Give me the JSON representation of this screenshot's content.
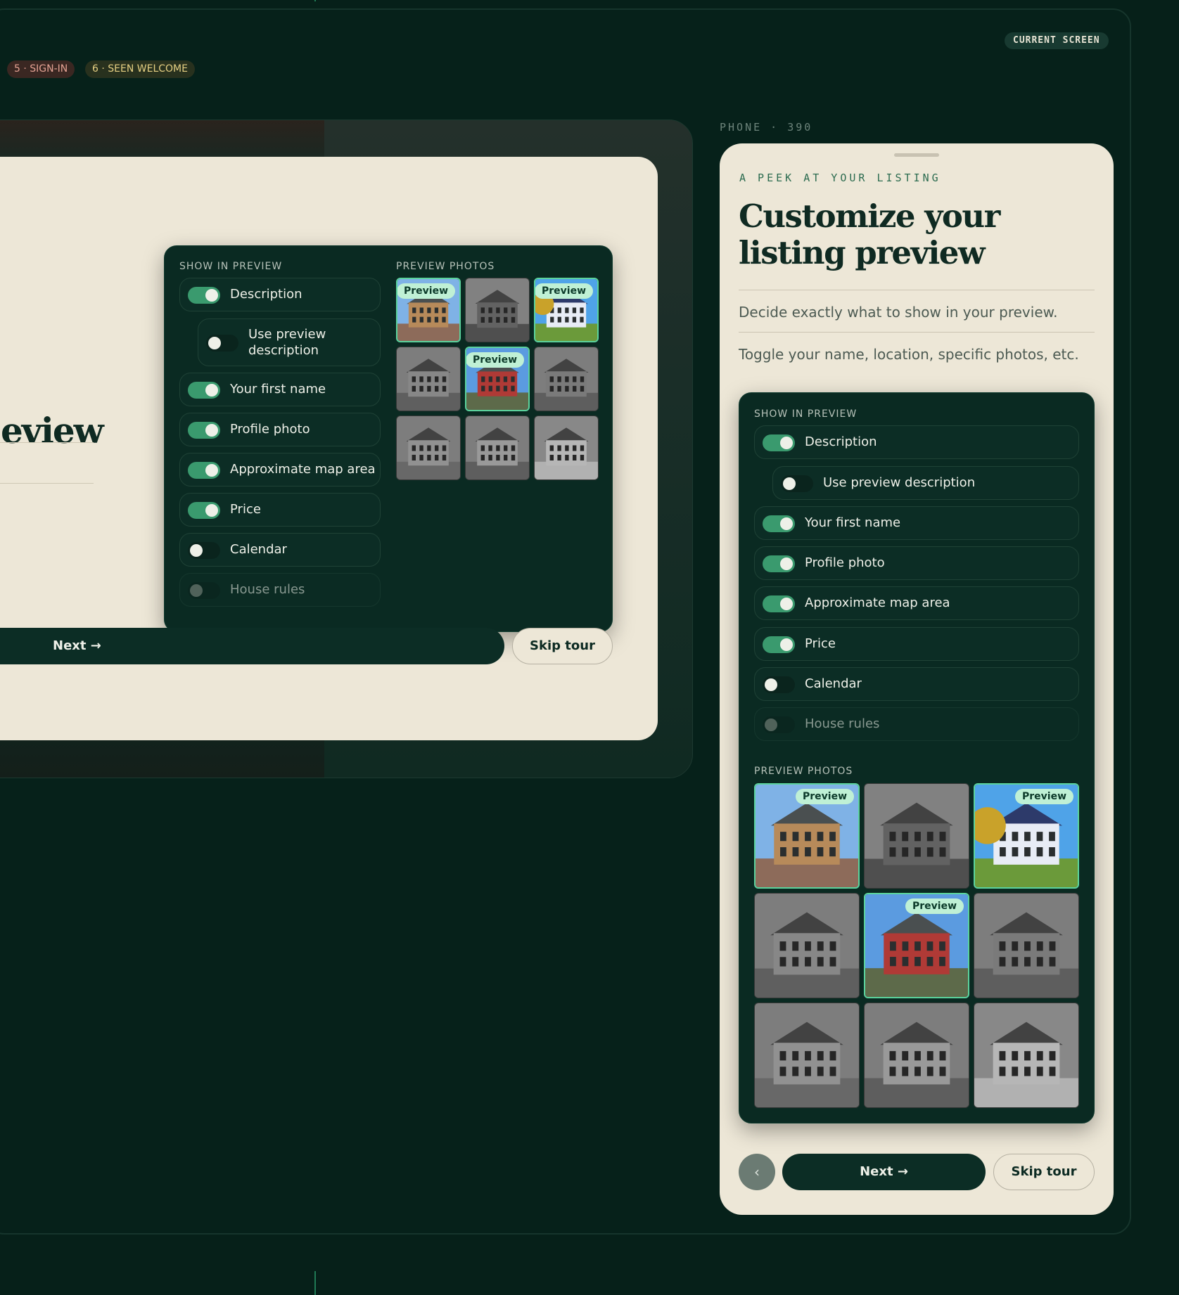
{
  "header": {
    "current_screen": "CURRENT SCREEN",
    "steps": [
      "5 · SIGN-IN",
      "6 · SEEN WELCOME"
    ]
  },
  "desktop": {
    "title_fragment": "eview",
    "panel": {
      "show_label": "SHOW IN PREVIEW",
      "photos_label": "PREVIEW PHOTOS"
    },
    "next_label": "Next →",
    "skip_label": "Skip tour"
  },
  "toggles": [
    {
      "label": "Description",
      "on": true,
      "nested": false
    },
    {
      "label": "Use preview description",
      "on": false,
      "nested": true
    },
    {
      "label": "Your first name",
      "on": true,
      "nested": false
    },
    {
      "label": "Profile photo",
      "on": true,
      "nested": false
    },
    {
      "label": "Approximate map area",
      "on": true,
      "nested": false
    },
    {
      "label": "Price",
      "on": true,
      "nested": false
    },
    {
      "label": "Calendar",
      "on": false,
      "nested": false
    },
    {
      "label": "House rules",
      "on": false,
      "nested": false,
      "disabled": true
    }
  ],
  "desktop_nested_label": [
    "Use preview",
    "description"
  ],
  "photos": [
    {
      "selected": true,
      "badge": "Preview"
    },
    {
      "selected": false
    },
    {
      "selected": true,
      "badge": "Preview"
    },
    {
      "selected": false
    },
    {
      "selected": true,
      "badge": "Preview"
    },
    {
      "selected": false
    },
    {
      "selected": false
    },
    {
      "selected": false
    },
    {
      "selected": false
    }
  ],
  "phone": {
    "tag": "PHONE · 390",
    "eyebrow": "A PEEK AT YOUR LISTING",
    "title": "Customize your listing preview",
    "line1": "Decide exactly what to show in your preview.",
    "line2": "Toggle your name, location, specific photos, etc.",
    "show_label": "SHOW IN PREVIEW",
    "photos_label": "PREVIEW PHOTOS",
    "back_icon": "chevron-left-icon",
    "next_label": "Next →",
    "skip_label": "Skip tour"
  },
  "colors": {
    "background": "#062019",
    "card": "#ede7d7",
    "panel": "#0a2a22",
    "toggle_on": "#3a9a6e",
    "badge": "#bff0d5"
  }
}
